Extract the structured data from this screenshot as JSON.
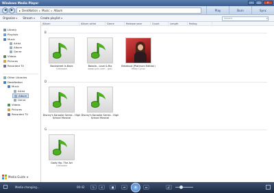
{
  "window": {
    "title": "Windows Media Player"
  },
  "nav": {
    "breadcrumb": [
      "DeskNation",
      "Music",
      "Album"
    ],
    "tabs": [
      "Play",
      "Burn",
      "Sync"
    ]
  },
  "toolbar": {
    "organize": "Organize",
    "stream": "Stream",
    "create_playlist": "Create playlist",
    "search_placeholder": "Search"
  },
  "sidebar": {
    "library": "Library",
    "playlists": "Playlists",
    "music": "Music",
    "artist": "Artist",
    "album": "Album",
    "genre": "Genre",
    "videos": "Videos",
    "pictures": "Pictures",
    "recorded_tv": "Recorded TV",
    "other_libraries": "Other Libraries",
    "desknation": "DeskNation",
    "music2": "Music",
    "artist2": "Artist",
    "album2": "Album",
    "genre2": "Genre",
    "videos2": "Videos",
    "pictures2": "Pictures",
    "recorded_tv2": "Recorded TV",
    "media_guide": "Media Guide"
  },
  "columns": [
    "Album",
    "Album artist",
    "Genre",
    "Release year",
    "Count",
    "Length",
    "Rating"
  ],
  "groups": [
    {
      "letter": "B",
      "albums": [
        {
          "title": "Backstreet Is Back",
          "artist": "Unknown"
        },
        {
          "title": "Balada - Love & Biz",
          "artist": "www.Lyric.com - (pd)"
        },
        {
          "title": "Breakout (Platinum Edition)",
          "artist": "Miley Cyrus"
        }
      ]
    },
    {
      "letter": "D",
      "albums": [
        {
          "title": "Disney's Karaoke Series - High School Musical",
          "artist": ""
        },
        {
          "title": "Disney's Karaoke Series - High School Musical",
          "artist": ""
        }
      ]
    },
    {
      "letter": "G",
      "albums": [
        {
          "title": "Gods Hip. The Art",
          "artist": "Unknown"
        }
      ]
    }
  ],
  "status": {
    "text": "Media changing...",
    "time": "00:42"
  },
  "controls": {
    "shuffle": "↻",
    "repeat": "⟲",
    "stop": "■",
    "prev": "⏮",
    "play_pause": "⏸",
    "next": "⏭",
    "mute": "🔊"
  },
  "colors": {
    "accent": "#3d5e8f",
    "note_green": "#4caf1f"
  }
}
